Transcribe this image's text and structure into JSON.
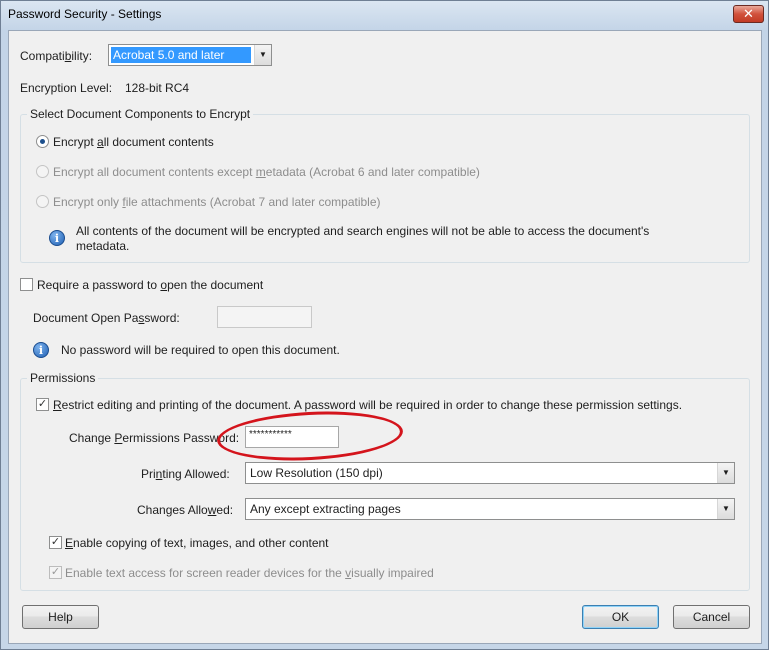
{
  "window": {
    "title": "Password Security - Settings",
    "close_glyph": "✕"
  },
  "compatibility": {
    "label_pre": "Compati",
    "label_u": "b",
    "label_post": "ility:",
    "value": "Acrobat 5.0 and later"
  },
  "encryption": {
    "label": "Encryption  Level:",
    "value": "128-bit RC4"
  },
  "components": {
    "group_label": "Select Document Components to Encrypt",
    "options": [
      {
        "pre": "Encrypt ",
        "u": "a",
        "post": "ll document contents",
        "checked": true,
        "enabled": true
      },
      {
        "pre": "Encrypt all document contents except ",
        "u": "m",
        "post": "etadata (Acrobat 6 and later compatible)",
        "checked": false,
        "enabled": false
      },
      {
        "pre": "Encrypt only ",
        "u": "f",
        "post": "ile attachments (Acrobat 7 and later compatible)",
        "checked": false,
        "enabled": false
      }
    ],
    "info_line1": "All contents of the document will be encrypted and search engines will not be able to access the document's",
    "info_line2": "metadata."
  },
  "open_password": {
    "checkbox_pre": "Require a password to ",
    "checkbox_u": "o",
    "checkbox_post": "pen the document",
    "field_pre": "Document Open Pa",
    "field_u": "s",
    "field_post": "sword:",
    "value": "",
    "info": "No password will be required to open this document."
  },
  "permissions": {
    "group_label": "Permissions",
    "restrict_pre": "",
    "restrict_u": "R",
    "restrict_post": "estrict editing and printing of the document. A password will be required in order to change these permission settings.",
    "change_pw_pre": "Change ",
    "change_pw_u": "P",
    "change_pw_post": "ermissions Password:",
    "change_pw_value": "***********",
    "printing_pre": "Pri",
    "printing_u": "n",
    "printing_post": "ting Allowed:",
    "printing_value": "Low Resolution (150 dpi)",
    "changes_pre": "Changes Allo",
    "changes_u": "w",
    "changes_post": "ed:",
    "changes_value": "Any except extracting pages",
    "copy_pre": "",
    "copy_u": "E",
    "copy_post": "nable copying of text, images, and other content",
    "screen_reader_pre": "Enable text access for screen reader devices for the ",
    "screen_reader_u": "v",
    "screen_reader_post": "isually impaired"
  },
  "buttons": {
    "help": "Help",
    "ok": "OK",
    "cancel": "Cancel"
  },
  "icons": {
    "info": "i",
    "dropdown": "▼",
    "check": "✓"
  },
  "colors": {
    "annotation": "#d4141c",
    "selection": "#3399ff"
  }
}
